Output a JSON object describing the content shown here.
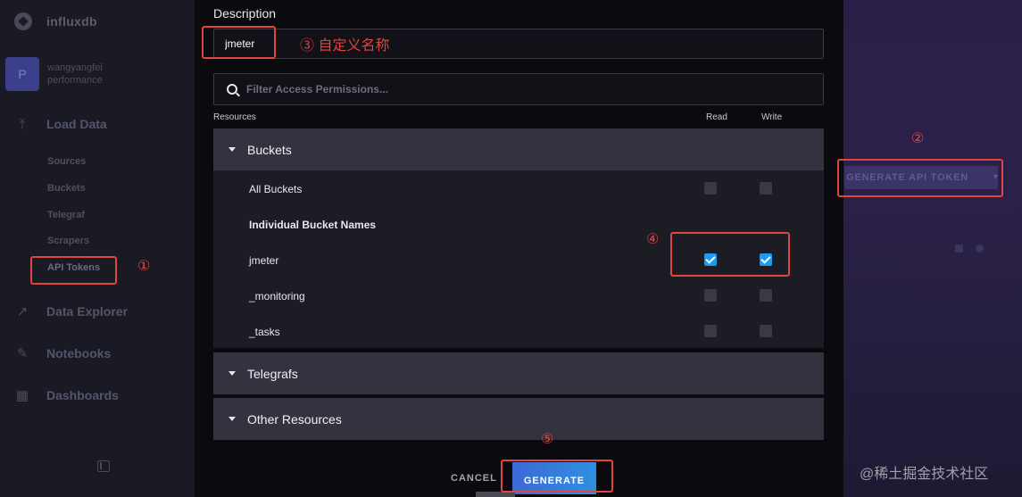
{
  "sidebar": {
    "brand": "influxdb",
    "org_initial": "P",
    "org_user": "wangyangfei",
    "org_name": "performance",
    "nav": {
      "load_data": "Load Data",
      "data_explorer": "Data Explorer",
      "notebooks": "Notebooks",
      "dashboards": "Dashboards"
    },
    "sub_items": [
      "Sources",
      "Buckets",
      "Telegraf",
      "Scrapers",
      "API Tokens"
    ]
  },
  "modal": {
    "description_label": "Description",
    "description_value": "jmeter",
    "filter_placeholder": "Filter Access Permissions...",
    "columns": {
      "resources": "Resources",
      "read": "Read",
      "write": "Write"
    },
    "sections": {
      "buckets": "Buckets",
      "telegrafs": "Telegrafs",
      "other": "Other Resources"
    },
    "rows": {
      "all_buckets": "All Buckets",
      "individual_header": "Individual Bucket Names",
      "bucket_1": "jmeter",
      "bucket_2": "_monitoring",
      "bucket_3": "_tasks"
    },
    "checkbox_states": {
      "all_buckets": {
        "read": false,
        "write": false
      },
      "jmeter": {
        "read": true,
        "write": true
      },
      "_monitoring": {
        "read": false,
        "write": false
      },
      "_tasks": {
        "read": false,
        "write": false
      }
    },
    "cancel_label": "CANCEL",
    "generate_label": "GENERATE"
  },
  "background": {
    "generate_token_label": "GENERATE API TOKEN",
    "watermark": "@稀土掘金技术社区"
  },
  "annotations": {
    "n1": "①",
    "n2": "②",
    "n3": "③ 自定义名称",
    "n4": "④",
    "n5": "⑤"
  },
  "colors": {
    "annotation_red": "#e0453f",
    "checkbox_blue": "#1d9bf0",
    "generate_button": "#3b6ad6"
  }
}
